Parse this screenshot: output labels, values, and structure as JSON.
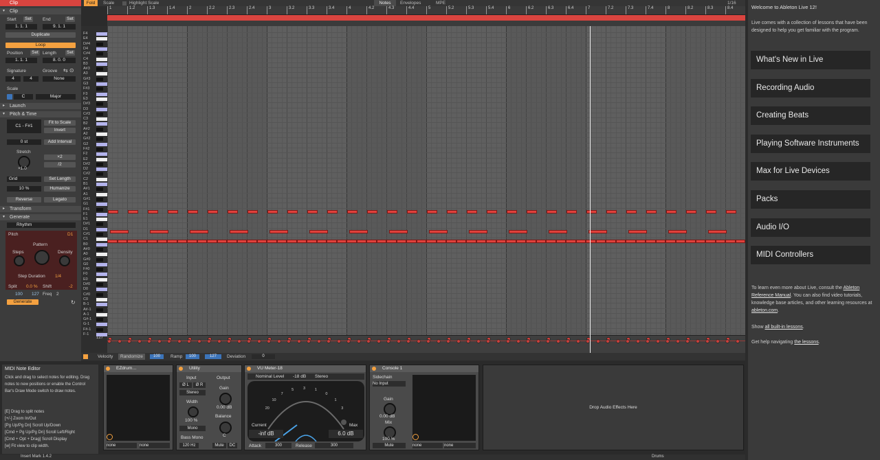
{
  "clip_panel": {
    "title": "Clip",
    "section_clip": "Clip",
    "start_label": "Start",
    "start_set": "Set",
    "end_label": "End",
    "end_set": "Set",
    "start_value": "1.  1.  1",
    "end_value": "9.  1.  1",
    "duplicate": "Duplicate",
    "loop": "Loop",
    "position_label": "Position",
    "position_set": "Set",
    "length_label": "Length",
    "length_set": "Set",
    "position_value": "1.  1.  1",
    "length_value": "8.  0.  0",
    "signature_label": "Signature",
    "sig_num": "4",
    "sig_den": "4",
    "groove_label": "Groove",
    "groove_value": "None",
    "scale_label": "Scale",
    "scale_root": "C",
    "scale_mode": "Major",
    "section_launch": "Launch",
    "section_pitch_time": "Pitch & Time",
    "range_value": "C1 - F#1",
    "fit_to_scale": "Fit to Scale",
    "invert": "Invert",
    "transpose_value": "0 st",
    "add_interval": "Add Interval",
    "stretch_label": "Stretch",
    "stretch_value": "×1.0",
    "times2": "×2",
    "div2": "/2",
    "grid_label": "Grid",
    "set_length": "Set Length",
    "grid_percent": "10 %",
    "humanize": "Humanize",
    "reverse": "Reverse",
    "legato": "Legato",
    "section_transform": "Transform",
    "section_generate": "Generate",
    "generator": "Rhythm",
    "pitch_label": "Pitch",
    "pitch_value": "D1",
    "pattern_label": "Pattern",
    "steps_label": "Steps",
    "density_label": "Density",
    "step_duration_label": "Step Duration",
    "step_duration_value": "1/4",
    "split_label": "Split",
    "split_value": "0.0 %",
    "shift_label": "Shift",
    "shift_value": "-2",
    "v_low": "100",
    "v_high": "127",
    "freq_label": "Freq",
    "freq_value": "2",
    "generate_btn": "Generate"
  },
  "top_bar": {
    "fold": "Fold",
    "scale": "Scale",
    "highlight_scale": "Highlight Scale",
    "tab_notes": "Notes",
    "tab_envelopes": "Envelopes",
    "tab_mpe": "MPE",
    "quantize": "1/16"
  },
  "ruler_ticks": [
    "1",
    "1.2",
    "1.3",
    "1.4",
    "2",
    "2.2",
    "2.3",
    "2.4",
    "3",
    "3.2",
    "3.3",
    "3.4",
    "4",
    "4.2",
    "4.3",
    "4.4",
    "5",
    "5.2",
    "5.3",
    "5.4",
    "6",
    "6.2",
    "6.3",
    "6.4",
    "7",
    "7.2",
    "7.3",
    "7.4",
    "8",
    "8.2",
    "8.3",
    "8.4"
  ],
  "key_labels": [
    "F4",
    "E4",
    "D#4",
    "D4",
    "C#4",
    "C4",
    "B3",
    "A#3",
    "A3",
    "G#3",
    "G3",
    "F#3",
    "F3",
    "E3",
    "D#3",
    "D3",
    "C#3",
    "C3",
    "B2",
    "A#2",
    "A2",
    "G#2",
    "G2",
    "F#2",
    "F2",
    "E2",
    "D#2",
    "D2",
    "C#2",
    "C2",
    "B1",
    "A#1",
    "A1",
    "G#1",
    "G1",
    "F#1",
    "F1",
    "E1",
    "D#1",
    "D1",
    "C#1",
    "C1",
    "B0",
    "A#0",
    "A0",
    "G#0",
    "G0",
    "F#0",
    "F0",
    "E0",
    "D#0",
    "D0",
    "C#0",
    "C0",
    "B-1",
    "A#-1",
    "A-1",
    "G#-1",
    "G-1",
    "F#-1",
    "F-1"
  ],
  "velocity_max": "127",
  "velocity_bar": {
    "velocity": "Velocity",
    "randomize": "Randomize",
    "velocity_value": "100",
    "ramp": "Ramp",
    "ramp_from": "100",
    "ramp_to": "127",
    "deviation": "Deviation",
    "deviation_value": "0"
  },
  "help": {
    "title": "Welcome to Ableton Live 12!",
    "intro": "Live comes with a collection of lessons that have been designed to help you get familiar with the program.",
    "lessons": [
      "What's New in Live",
      "Recording Audio",
      "Creating Beats",
      "Playing Software Instruments",
      "Max for Live Devices",
      "Packs",
      "Audio I/O",
      "MIDI Controllers"
    ],
    "more_1": "To learn even more about Live, consult the",
    "ref_manual": "Ableton Reference Manual",
    "more_2": ". You can also find video tutorials, knowledge base articles, and other learning resources at",
    "site": "ableton.com",
    "show": "Show",
    "show_link": "all built-in lessons",
    "nav": "Get help navigating",
    "nav_link": "the lessons"
  },
  "note_editor_info": {
    "title": "MIDI Note Editor",
    "body": "Click and drag to select notes for editing. Drag notes to new positions or enable the Control Bar's Draw Mode switch to draw notes.",
    "shortcuts": [
      "[E] Drag to split notes",
      "[+/-] Zoom In/Out",
      "[Pg Up/Pg Dn] Scroll Up/Down",
      "[Cmd + Pg Up/Pg Dn] Scroll Left/Right",
      "[Cmd + Opt + Drag] Scroll Display",
      "[w] Fit view to clip width."
    ]
  },
  "devices": {
    "ezdrummer": {
      "title": "EZdrum…",
      "none1": "none",
      "none2": "none"
    },
    "utility": {
      "title": "Utility",
      "input": "Input",
      "output": "Output",
      "phase_l": "Ø L",
      "phase_r": "Ø R",
      "stereo": "Stereo",
      "width": "Width",
      "width_value": "100 %",
      "mono": "Mono",
      "bass_mono": "Bass Mono",
      "bass_freq": "120 Hz",
      "gain": "Gain",
      "gain_value": "0.00 dB",
      "balance": "Balance",
      "balance_value": "C",
      "mute": "Mute",
      "dc": "DC"
    },
    "vu": {
      "title": "VU Meter-18",
      "nominal": "Nominal Level",
      "nominal_value": "-18 dB",
      "stereo": "Stereo",
      "current": "Current",
      "current_value": "-inf dB",
      "max": "Max",
      "max_value": "6.0 dB",
      "attack": "Attack",
      "attack_value": "300",
      "release": "Release",
      "release_value": "300",
      "scale": [
        "20",
        "10",
        "7",
        "5",
        "3",
        "1",
        "0",
        "1",
        "3"
      ]
    },
    "console": {
      "title": "Console 1",
      "sidechain": "Sidechain",
      "no_input": "No Input",
      "gain": "Gain",
      "gain_value": "0.00 dB",
      "mix": "Mix",
      "mix_value": "100 %",
      "mute": "Mute",
      "none1": "none",
      "none2": "none"
    },
    "drop_zone": "Drop Audio Effects Here"
  },
  "status": {
    "left": "Insert Mark 1.4.2",
    "right": "Drums"
  },
  "colors": {
    "note": "#e0413c",
    "accent": "#f4a140",
    "loop": "#d9443f"
  }
}
